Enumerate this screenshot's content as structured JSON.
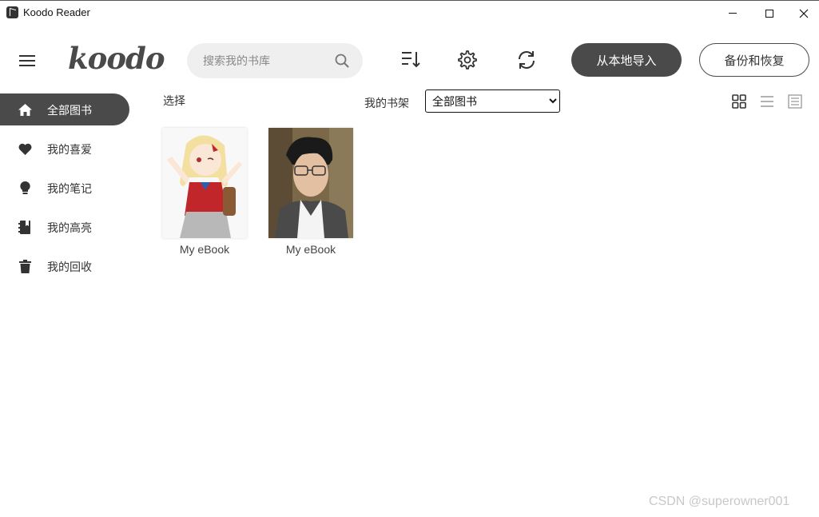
{
  "window": {
    "title": "Koodo Reader"
  },
  "header": {
    "logo_text": "koodo",
    "search_placeholder": "搜索我的书库",
    "import_label": "从本地导入",
    "backup_label": "备份和恢复"
  },
  "sidebar": {
    "items": [
      {
        "label": "全部图书",
        "icon": "home-icon",
        "active": true
      },
      {
        "label": "我的喜爱",
        "icon": "heart-icon",
        "active": false
      },
      {
        "label": "我的笔记",
        "icon": "lightbulb-icon",
        "active": false
      },
      {
        "label": "我的高亮",
        "icon": "notebook-icon",
        "active": false
      },
      {
        "label": "我的回收",
        "icon": "trash-icon",
        "active": false
      }
    ]
  },
  "toolbar": {
    "select_label": "选择",
    "shelf_label": "我的书架",
    "shelf_selected": "全部图书"
  },
  "books": [
    {
      "title": "My eBook"
    },
    {
      "title": "My eBook"
    }
  ],
  "watermark": "CSDN @superowner001",
  "colors": {
    "accent": "#4a4a4a",
    "search_bg": "#efefef"
  }
}
